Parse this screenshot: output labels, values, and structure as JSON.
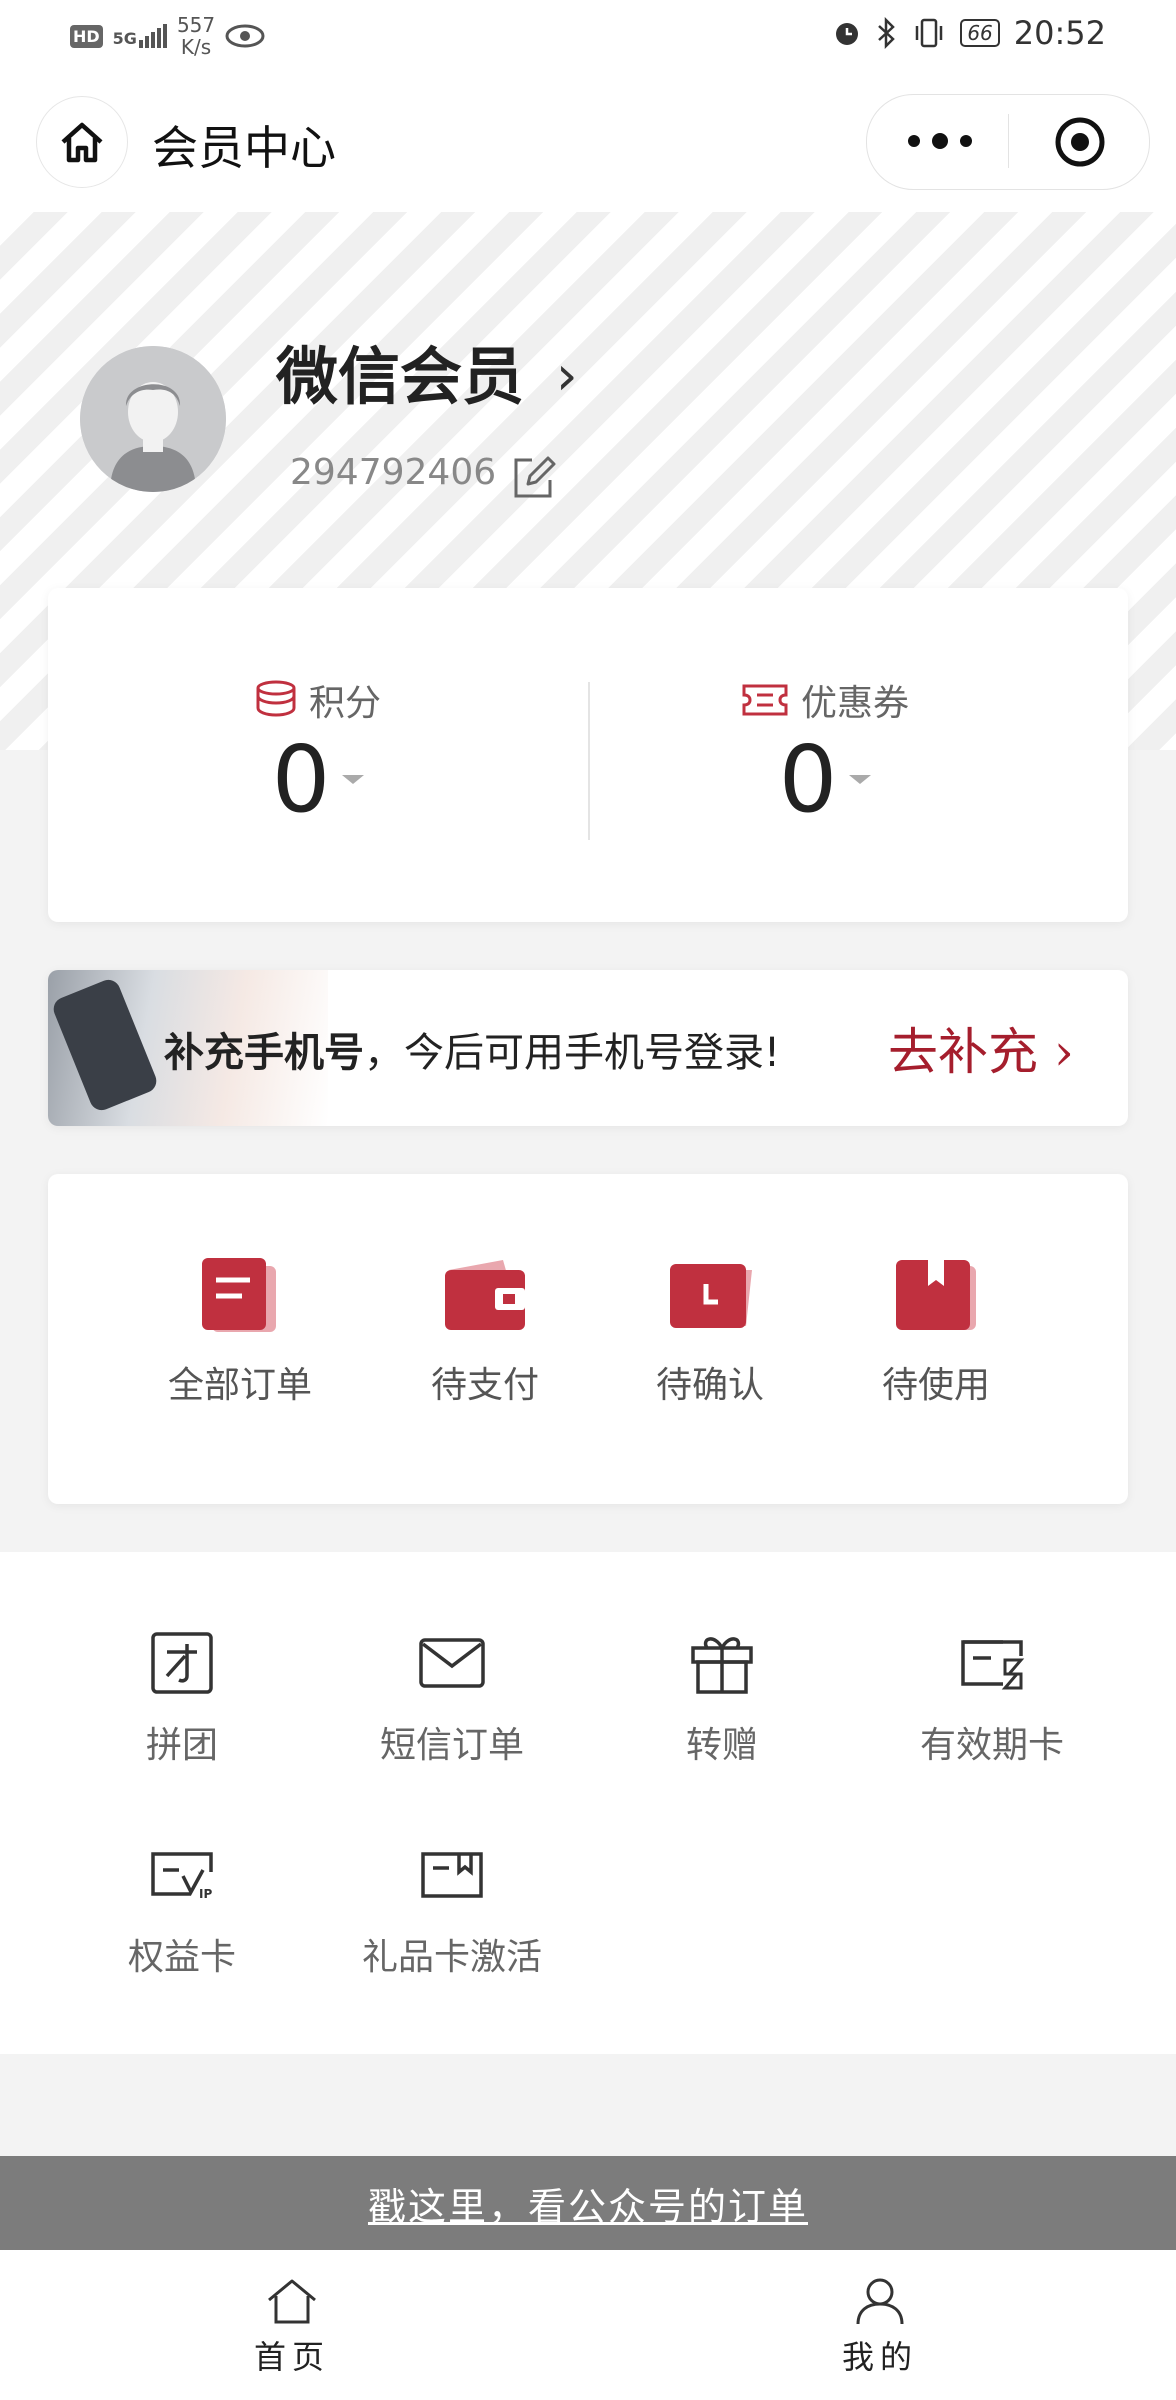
{
  "status_bar": {
    "network_badge": "HD",
    "signal": "5G",
    "speed_value": "557",
    "speed_unit": "K/s",
    "battery": "66",
    "time": "20:52"
  },
  "nav": {
    "title": "会员中心"
  },
  "profile": {
    "name": "微信会员",
    "member_id": "294792406"
  },
  "stats": [
    {
      "label": "积分",
      "value": "0"
    },
    {
      "label": "优惠券",
      "value": "0"
    }
  ],
  "banner": {
    "bold_text": "补充手机号",
    "text": "，今后可用手机号登录!",
    "cta": "去补充 ›"
  },
  "orders": [
    {
      "label": "全部订单",
      "icon": "all-orders-icon"
    },
    {
      "label": "待支付",
      "icon": "wallet-icon"
    },
    {
      "label": "待确认",
      "icon": "clock-icon"
    },
    {
      "label": "待使用",
      "icon": "bookmark-icon"
    }
  ],
  "services": [
    {
      "label": "拼团",
      "icon": "group-buy-icon"
    },
    {
      "label": "短信订单",
      "icon": "envelope-icon"
    },
    {
      "label": "转赠",
      "icon": "gift-icon"
    },
    {
      "label": "有效期卡",
      "icon": "hourglass-card-icon"
    },
    {
      "label": "权益卡",
      "icon": "vip-card-icon"
    },
    {
      "label": "礼品卡激活",
      "icon": "gift-card-icon"
    }
  ],
  "gzh_link": "戳这里，看公众号的订单",
  "tabs": [
    {
      "label": "首页",
      "icon": "home-icon"
    },
    {
      "label": "我的",
      "icon": "user-icon"
    }
  ],
  "colors": {
    "brand_red": "#a51e2d",
    "icon_red": "#c0303f"
  }
}
